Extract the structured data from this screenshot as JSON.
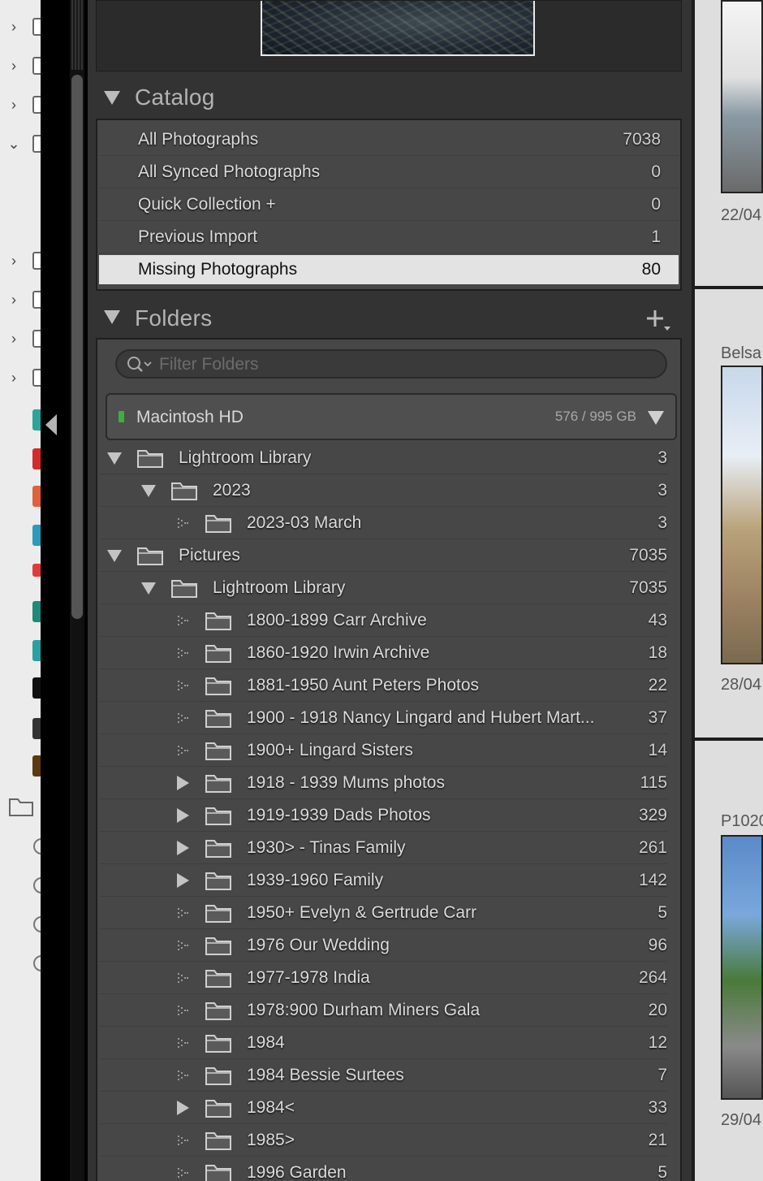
{
  "catalog": {
    "title": "Catalog",
    "items": [
      {
        "label": "All Photographs",
        "count": "7038"
      },
      {
        "label": "All Synced Photographs",
        "count": "0"
      },
      {
        "label": "Quick Collection  +",
        "count": "0"
      },
      {
        "label": "Previous Import",
        "count": "1"
      },
      {
        "label": "Missing Photographs",
        "count": "80",
        "selected": true
      }
    ]
  },
  "folders": {
    "title": "Folders",
    "add_icon": "plus-dropdown-icon",
    "filter_placeholder": "Filter Folders",
    "volume": {
      "name": "Macintosh HD",
      "size": "576 / 995 GB",
      "status_color": "#3fae3f"
    },
    "tree": [
      {
        "label": "Lightroom Library",
        "count": "3",
        "depth": 0,
        "state": "expanded"
      },
      {
        "label": "2023",
        "count": "3",
        "depth": 1,
        "state": "expanded"
      },
      {
        "label": "2023-03 March",
        "count": "3",
        "depth": 2,
        "state": "leaf"
      },
      {
        "label": "Pictures",
        "count": "7035",
        "depth": 0,
        "state": "expanded"
      },
      {
        "label": "Lightroom Library",
        "count": "7035",
        "depth": 1,
        "state": "expanded"
      },
      {
        "label": "1800-1899 Carr Archive",
        "count": "43",
        "depth": 2,
        "state": "leaf"
      },
      {
        "label": "1860-1920  Irwin Archive",
        "count": "18",
        "depth": 2,
        "state": "leaf"
      },
      {
        "label": "1881-1950 Aunt Peters Photos",
        "count": "22",
        "depth": 2,
        "state": "leaf"
      },
      {
        "label": "1900 - 1918 Nancy Lingard and Hubert Mart...",
        "count": "37",
        "depth": 2,
        "state": "leaf"
      },
      {
        "label": "1900+ Lingard Sisters",
        "count": "14",
        "depth": 2,
        "state": "leaf"
      },
      {
        "label": "1918 - 1939 Mums photos",
        "count": "115",
        "depth": 2,
        "state": "collapsed"
      },
      {
        "label": "1919-1939 Dads Photos",
        "count": "329",
        "depth": 2,
        "state": "collapsed"
      },
      {
        "label": "1930> - Tinas Family",
        "count": "261",
        "depth": 2,
        "state": "collapsed"
      },
      {
        "label": "1939-1960 Family",
        "count": "142",
        "depth": 2,
        "state": "collapsed"
      },
      {
        "label": "1950+ Evelyn & Gertrude Carr",
        "count": "5",
        "depth": 2,
        "state": "leaf"
      },
      {
        "label": "1976 Our Wedding",
        "count": "96",
        "depth": 2,
        "state": "leaf"
      },
      {
        "label": "1977-1978 India",
        "count": "264",
        "depth": 2,
        "state": "leaf"
      },
      {
        "label": "1978:900 Durham Miners Gala",
        "count": "20",
        "depth": 2,
        "state": "leaf"
      },
      {
        "label": "1984",
        "count": "12",
        "depth": 2,
        "state": "leaf"
      },
      {
        "label": "1984 Bessie Surtees",
        "count": "7",
        "depth": 2,
        "state": "leaf"
      },
      {
        "label": "1984<",
        "count": "33",
        "depth": 2,
        "state": "collapsed"
      },
      {
        "label": "1985>",
        "count": "21",
        "depth": 2,
        "state": "leaf"
      },
      {
        "label": "1996 Garden",
        "count": "5",
        "depth": 2,
        "state": "leaf"
      }
    ]
  },
  "grid": {
    "cells": [
      {
        "name": "",
        "date": "22/04"
      },
      {
        "name": "Belsa",
        "date": "28/04"
      },
      {
        "name": "P1020",
        "date": "29/04"
      }
    ]
  },
  "colors": {
    "panel_bg": "#333333",
    "list_bg": "#474747",
    "selected_row": "#e3e3e3",
    "text": "#dcdcdc"
  }
}
